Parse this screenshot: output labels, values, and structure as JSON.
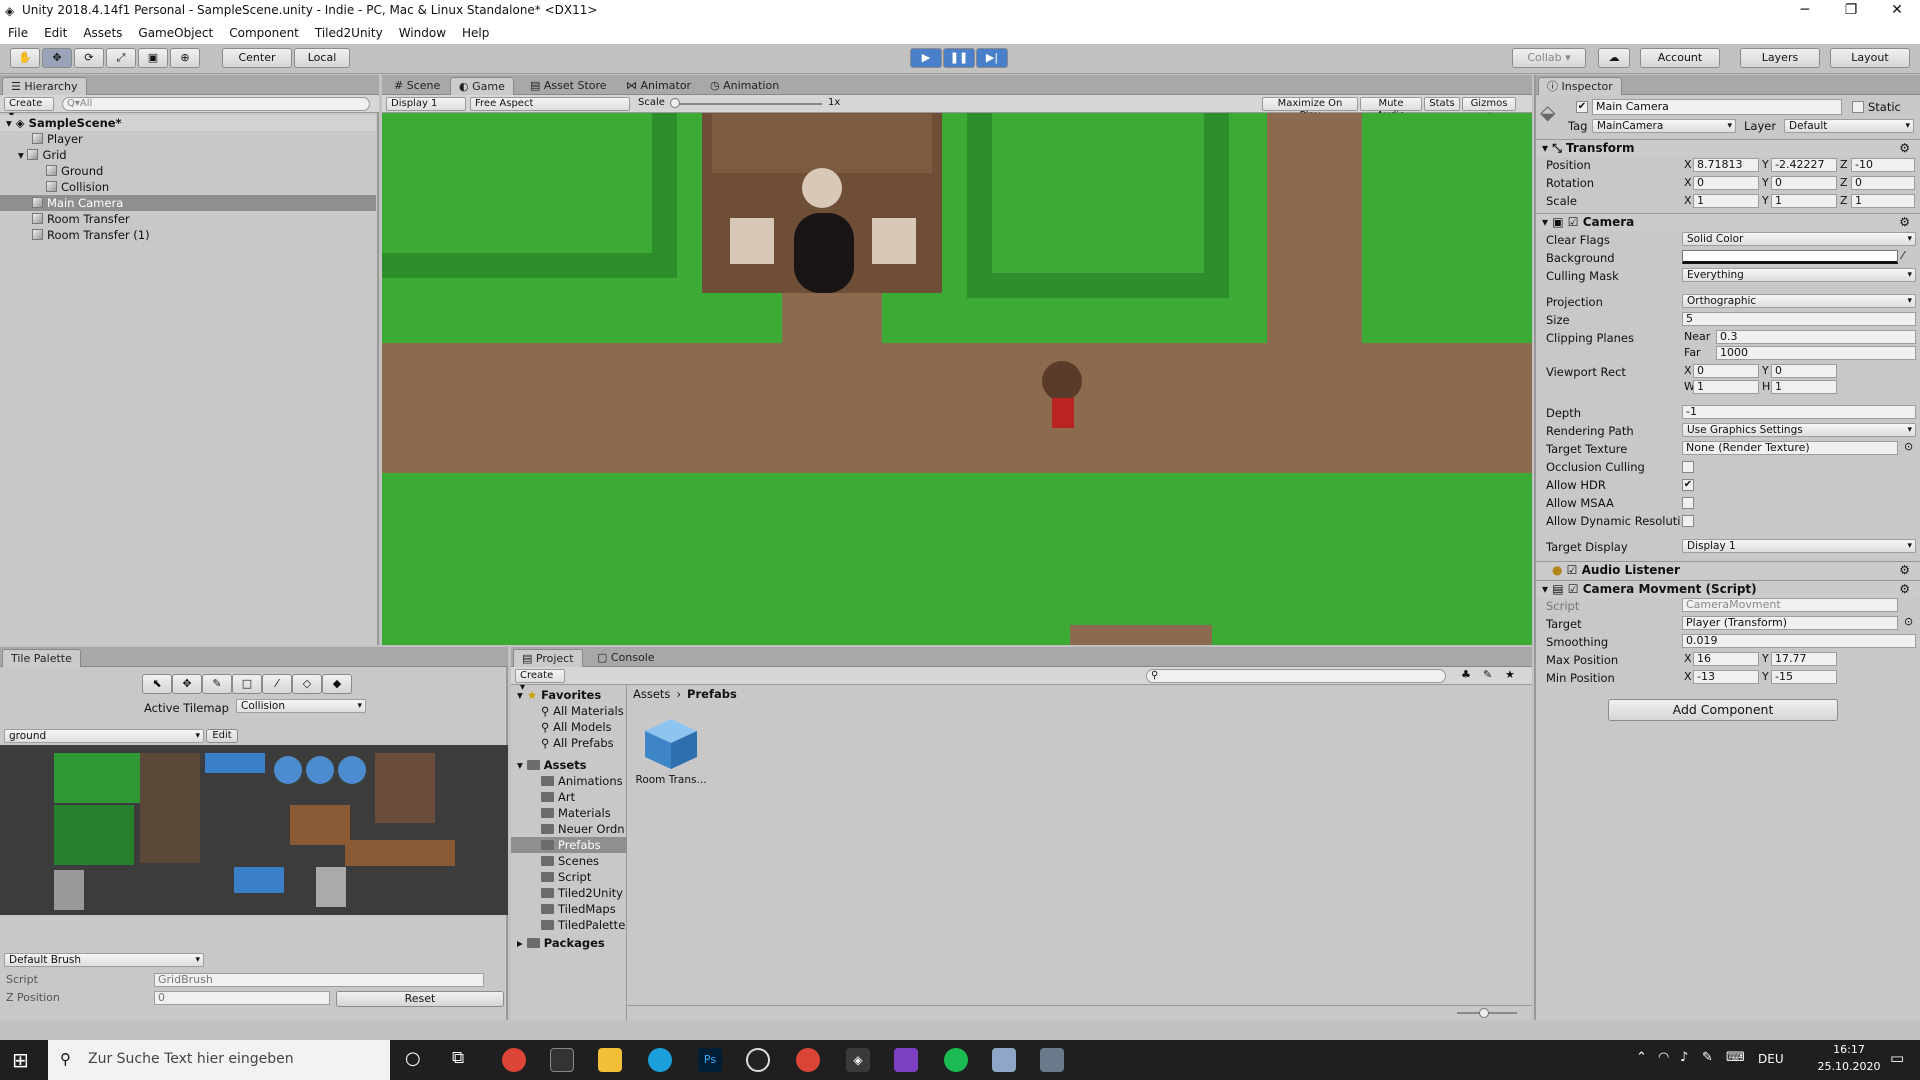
{
  "window": {
    "title": "Unity 2018.4.14f1 Personal - SampleScene.unity - Indie - PC, Mac & Linux Standalone* <DX11>",
    "minimize": "─",
    "maximize": "❐",
    "close": "✕"
  },
  "menu": [
    "File",
    "Edit",
    "Assets",
    "GameObject",
    "Component",
    "Tiled2Unity",
    "Window",
    "Help"
  ],
  "toolbar": {
    "pivot": "Center",
    "space": "Local",
    "collab": "Collab ▾",
    "account": "Account",
    "layers": "Layers",
    "layout": "Layout"
  },
  "hierarchy": {
    "tab": "Hierarchy",
    "create": "Create ▾",
    "search_placeholder": "Q▾All",
    "scene": "SampleScene*",
    "items": [
      {
        "label": "Player"
      },
      {
        "label": "Grid"
      },
      {
        "label": "Ground"
      },
      {
        "label": "Collision"
      },
      {
        "label": "Main Camera"
      },
      {
        "label": "Room Transfer"
      },
      {
        "label": "Room Transfer (1)"
      }
    ]
  },
  "center_tabs": [
    "Scene",
    "Game",
    "Asset Store",
    "Animator",
    "Animation"
  ],
  "game_bar": {
    "display": "Display 1",
    "aspect": "Free Aspect",
    "scale_label": "Scale",
    "scale_value": "1x",
    "maximize": "Maximize On Play",
    "mute": "Mute Audio",
    "stats": "Stats",
    "gizmos": "Gizmos ▾"
  },
  "tile_palette": {
    "tab": "Tile Palette",
    "active_tilemap_label": "Active Tilemap",
    "active_tilemap": "Collision",
    "palette": "ground",
    "edit": "Edit",
    "brush": "Default Brush",
    "script_label": "Script",
    "script_value": "GridBrush",
    "zpos_label": "Z Position",
    "zpos_value": "0",
    "reset": "Reset"
  },
  "project": {
    "tabs": [
      "Project",
      "Console"
    ],
    "create": "Create ▾",
    "favorites": "Favorites",
    "fav_items": [
      "All Materials",
      "All Models",
      "All Prefabs"
    ],
    "assets": "Assets",
    "folders": [
      "Animations",
      "Art",
      "Materials",
      "Neuer Ordn",
      "Prefabs",
      "Scenes",
      "Script",
      "Tiled2Unity",
      "TiledMaps",
      "TiledPalette"
    ],
    "packages": "Packages",
    "breadcrumb": [
      "Assets",
      "Prefabs"
    ],
    "files": [
      {
        "label": "Room Trans..."
      }
    ]
  },
  "inspector": {
    "tab": "Inspector",
    "object_name": "Main Camera",
    "static_label": "Static",
    "tag_label": "Tag",
    "tag": "MainCamera",
    "layer_label": "Layer",
    "layer": "Default",
    "transform": {
      "title": "Transform",
      "position_label": "Position",
      "pos": [
        "8.71813",
        "-2.42227",
        "-10"
      ],
      "rotation_label": "Rotation",
      "rot": [
        "0",
        "0",
        "0"
      ],
      "scale_label": "Scale",
      "scale": [
        "1",
        "1",
        "1"
      ]
    },
    "camera": {
      "title": "Camera",
      "clear_flags_label": "Clear Flags",
      "clear_flags": "Solid Color",
      "background_label": "Background",
      "culling_label": "Culling Mask",
      "culling": "Everything",
      "projection_label": "Projection",
      "projection": "Orthographic",
      "size_label": "Size",
      "size": "5",
      "clipping_label": "Clipping Planes",
      "near_label": "Near",
      "near": "0.3",
      "far_label": "Far",
      "far": "1000",
      "viewport_label": "Viewport Rect",
      "vp": [
        "0",
        "0",
        "1",
        "1"
      ],
      "depth_label": "Depth",
      "depth": "-1",
      "rendering_label": "Rendering Path",
      "rendering": "Use Graphics Settings",
      "target_texture_label": "Target Texture",
      "target_texture": "None (Render Texture)",
      "occlusion_label": "Occlusion Culling",
      "hdr_label": "Allow HDR",
      "msaa_label": "Allow MSAA",
      "dyn_label": "Allow Dynamic Resoluti",
      "target_display_label": "Target Display",
      "target_display": "Display 1"
    },
    "audio_listener": {
      "title": "Audio Listener"
    },
    "movement": {
      "title": "Camera Movment (Script)",
      "script_label": "Script",
      "script": "CameraMovment",
      "target_label": "Target",
      "target": "Player (Transform)",
      "smoothing_label": "Smoothing",
      "smoothing": "0.019",
      "maxpos_label": "Max Position",
      "maxpos": [
        "16",
        "17.77"
      ],
      "minpos_label": "Min Position",
      "minpos": [
        "-13",
        "-15"
      ]
    },
    "add_component": "Add Component"
  },
  "axis": {
    "x": "X",
    "y": "Y",
    "z": "Z",
    "w": "W",
    "h": "H"
  },
  "taskbar": {
    "search_placeholder": "Zur Suche Text hier eingeben",
    "lang": "DEU",
    "time": "16:17",
    "date": "25.10.2020"
  }
}
